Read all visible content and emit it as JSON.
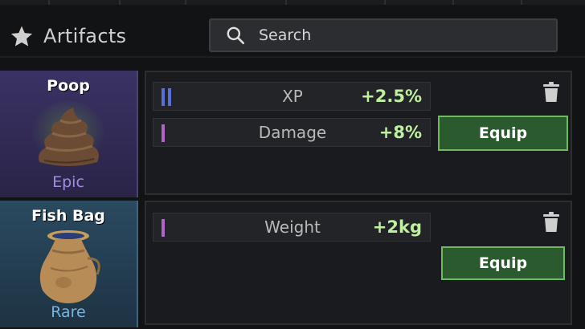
{
  "header": {
    "title": "Artifacts",
    "icon": "star-icon"
  },
  "search": {
    "placeholder": "Search",
    "icon": "search-icon"
  },
  "artifacts": [
    {
      "name": "Poop",
      "rarity": "Epic",
      "icon": "poop-icon",
      "stats": [
        {
          "name": "XP",
          "value": "+2.5%",
          "marker": "double-blue"
        },
        {
          "name": "Damage",
          "value": "+8%",
          "marker": "single-purple"
        }
      ],
      "equip_label": "Equip"
    },
    {
      "name": "Fish Bag",
      "rarity": "Rare",
      "icon": "fish-bag-icon",
      "stats": [
        {
          "name": "Weight",
          "value": "+2kg",
          "marker": "single-purple"
        }
      ],
      "equip_label": "Equip"
    }
  ],
  "colors": {
    "epic": "#3a3264",
    "rare": "#2a4a60",
    "stat_value": "#bff0a0",
    "equip_border": "#6fba5e"
  }
}
